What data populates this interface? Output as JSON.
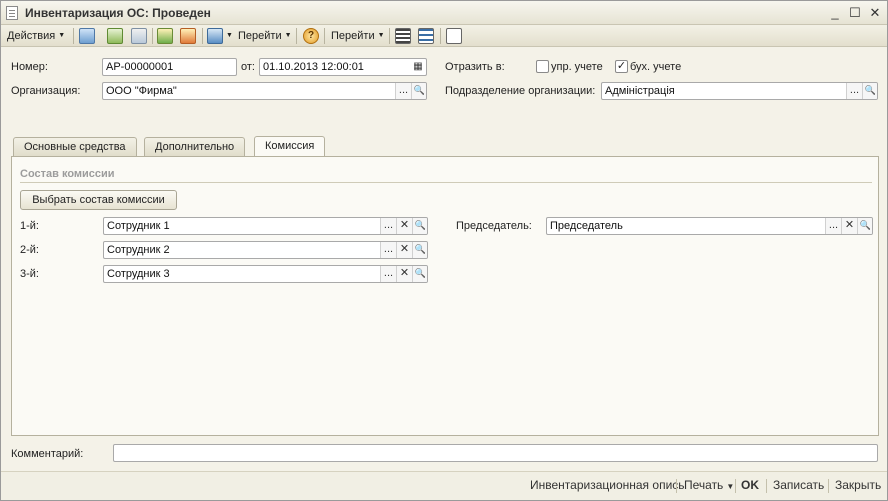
{
  "window": {
    "title": "Инвентаризация ОС: Проведен",
    "minimize": "_",
    "maximize": "☐",
    "close": "✕"
  },
  "toolbar": {
    "actions": "Действия",
    "goto1": "Перейти",
    "help": "?",
    "goto2": "Перейти"
  },
  "header": {
    "number_label": "Номер:",
    "number_value": "АР-00000001",
    "from_label": "от:",
    "date_value": "01.10.2013 12:00:01",
    "reflect_label": "Отразить в:",
    "mgmt_label": "упр. учете",
    "mgmt_checked": "",
    "acct_label": "бух. учете",
    "acct_checked": "✓",
    "org_label": "Организация:",
    "org_value": "ООО \"Фирма\"",
    "dept_label": "Подразделение организации:",
    "dept_value": "Адміністрація"
  },
  "tabs": [
    "Основные средства",
    "Дополнительно",
    "Комиссия"
  ],
  "commission": {
    "group_title": "Состав комиссии",
    "select_button": "Выбрать состав комиссии",
    "members": [
      {
        "label": "1-й:",
        "value": "Сотрудник 1"
      },
      {
        "label": "2-й:",
        "value": "Сотрудник 2"
      },
      {
        "label": "3-й:",
        "value": "Сотрудник 3"
      }
    ],
    "chair_label": "Председатель:",
    "chair_value": "Председатель"
  },
  "field_buttons": {
    "select": "...",
    "clear": "✕",
    "open": "🔍"
  },
  "comment": {
    "label": "Комментарий:",
    "value": ""
  },
  "statusbar": {
    "inventory": "Инвентаризационная опись",
    "print": "Печать",
    "ok": "OK",
    "save": "Записать",
    "close": "Закрыть"
  }
}
